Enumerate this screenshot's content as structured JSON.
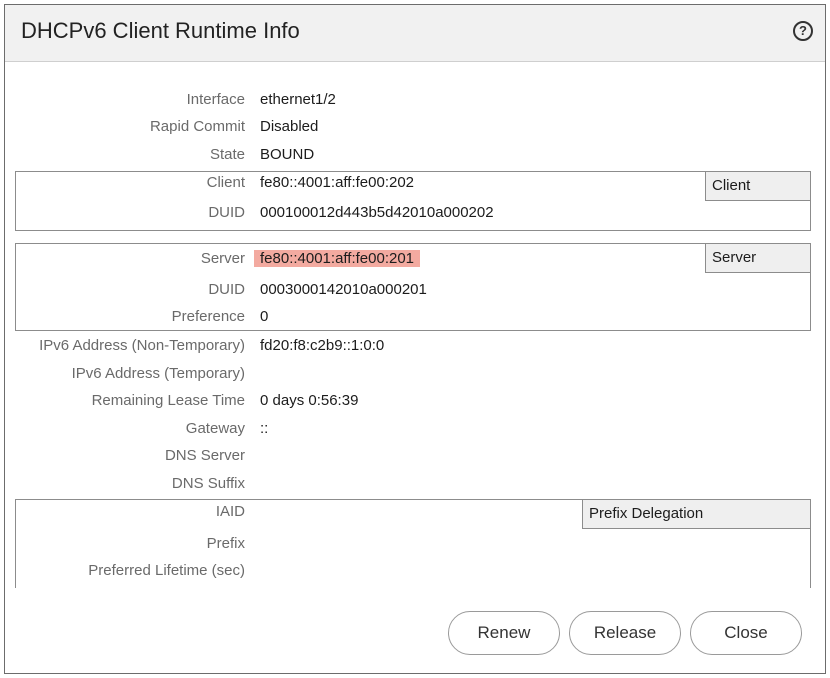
{
  "dialog": {
    "title": "DHCPv6 Client Runtime Info",
    "help_icon": "help-icon",
    "help_glyph": "?"
  },
  "rows": {
    "interface": {
      "label": "Interface",
      "value": "ethernet1/2"
    },
    "rapid_commit": {
      "label": "Rapid Commit",
      "value": "Disabled"
    },
    "state": {
      "label": "State",
      "value": "BOUND"
    }
  },
  "client_section": {
    "header": "Client",
    "client": {
      "label": "Client",
      "value": "fe80::4001:aff:fe00:202"
    },
    "duid": {
      "label": "DUID",
      "value": "000100012d443b5d42010a000202"
    }
  },
  "server_section": {
    "header": "Server",
    "highlight_color": "#f3aaa0",
    "server": {
      "label": "Server",
      "value": "fe80::4001:aff:fe00:201"
    },
    "duid": {
      "label": "DUID",
      "value": "0003000142010a000201"
    },
    "preference": {
      "label": "Preference",
      "value": "0"
    }
  },
  "details": {
    "ipv6_non_temp": {
      "label": "IPv6 Address (Non-Temporary)",
      "value": "fd20:f8:c2b9::1:0:0"
    },
    "ipv6_temp": {
      "label": "IPv6 Address (Temporary)",
      "value": ""
    },
    "lease": {
      "label": "Remaining Lease Time",
      "value": "0 days 0:56:39"
    },
    "gateway": {
      "label": "Gateway",
      "value": "::"
    },
    "dns_server": {
      "label": "DNS Server",
      "value": ""
    },
    "dns_suffix": {
      "label": "DNS Suffix",
      "value": ""
    }
  },
  "prefix_section": {
    "header": "Prefix Delegation",
    "iaid": {
      "label": "IAID",
      "value": ""
    },
    "prefix": {
      "label": "Prefix",
      "value": ""
    },
    "preferred_lifetime": {
      "label": "Preferred Lifetime (sec)",
      "value": ""
    }
  },
  "buttons": {
    "renew": "Renew",
    "release": "Release",
    "close": "Close"
  }
}
